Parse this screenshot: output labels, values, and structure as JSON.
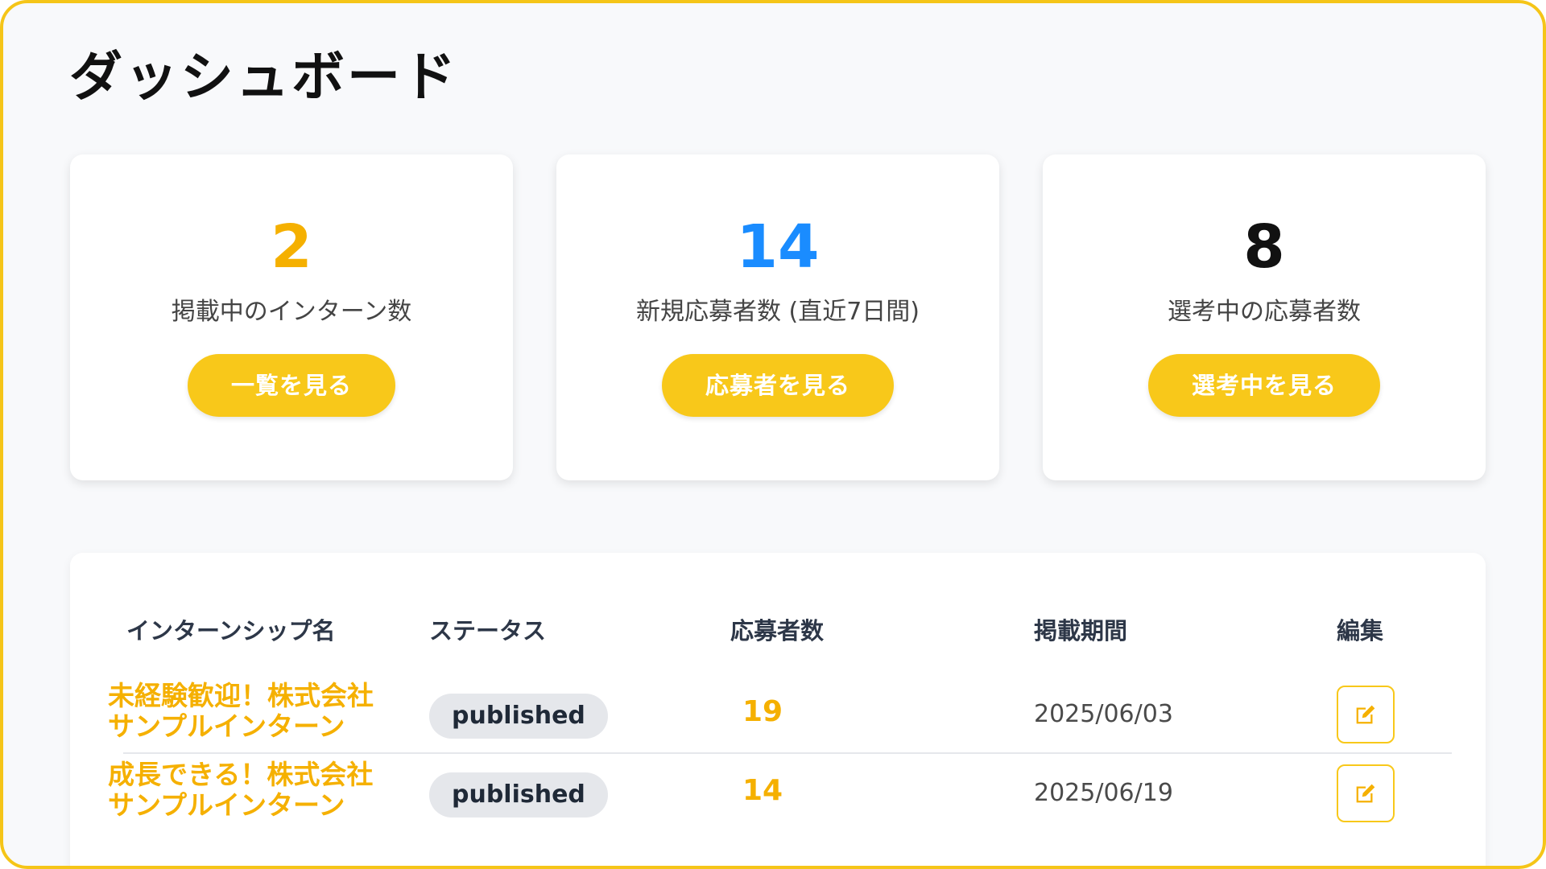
{
  "page": {
    "title": "ダッシュボード"
  },
  "colors": {
    "accent": "#f8c81a",
    "orange": "#f5b000",
    "blue": "#1a8cff",
    "border": "#f5c518"
  },
  "stats": [
    {
      "value": "2",
      "label": "掲載中のインターン数",
      "button": "一覧を見る",
      "color": "#f5b000"
    },
    {
      "value": "14",
      "label": "新規応募者数 (直近7日間)",
      "button": "応募者を見る",
      "color": "#1a8cff"
    },
    {
      "value": "8",
      "label": "選考中の応募者数",
      "button": "選考中を見る",
      "color": "#111111"
    }
  ],
  "table": {
    "headers": [
      "インターンシップ名",
      "ステータス",
      "応募者数",
      "掲載期間",
      "編集"
    ],
    "rows": [
      {
        "name_line1": "未経験歓迎！株式会社",
        "name_line2": "サンプルインターン",
        "status": "published",
        "applicants": "19",
        "date": "2025/06/03",
        "edit_icon": "edit-icon"
      },
      {
        "name_line1": "成長できる！株式会社",
        "name_line2": "サンプルインターン",
        "status": "published",
        "applicants": "14",
        "date": "2025/06/19",
        "edit_icon": "edit-icon"
      }
    ]
  }
}
